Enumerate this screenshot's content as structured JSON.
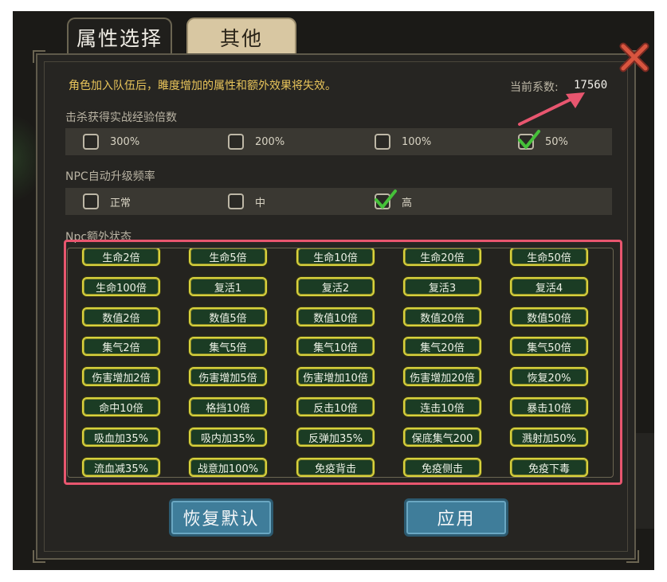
{
  "tabs": {
    "attribute": "属性选择",
    "other": "其他"
  },
  "notice": "角色加入队伍后，雎度增加的属性和额外效果将失效。",
  "coefficient": {
    "label": "当前系数:",
    "value": "17560"
  },
  "kill_exp": {
    "label": "击杀获得实战经验倍数",
    "options": [
      {
        "label": "300%",
        "checked": false
      },
      {
        "label": "200%",
        "checked": false
      },
      {
        "label": "100%",
        "checked": false
      },
      {
        "label": "50%",
        "checked": true
      }
    ]
  },
  "npc_upgrade": {
    "label": "NPC自动升级频率",
    "options": [
      {
        "label": "正常",
        "checked": false
      },
      {
        "label": "中",
        "checked": false
      },
      {
        "label": "高",
        "checked": true
      }
    ]
  },
  "npc_extra": {
    "label": "Npc额外状态",
    "buttons": [
      [
        "生命2倍",
        "生命5倍",
        "生命10倍",
        "生命20倍",
        "生命50倍"
      ],
      [
        "生命100倍",
        "复活1",
        "复活2",
        "复活3",
        "复活4"
      ],
      [
        "数值2倍",
        "数值5倍",
        "数值10倍",
        "数值20倍",
        "数值50倍"
      ],
      [
        "集气2倍",
        "集气5倍",
        "集气10倍",
        "集气20倍",
        "集气50倍"
      ],
      [
        "伤害增加2倍",
        "伤害增加5倍",
        "伤害增加10倍",
        "伤害增加20倍",
        "恢复20%"
      ],
      [
        "命中10倍",
        "格挡10倍",
        "反击10倍",
        "连击10倍",
        "暴击10倍"
      ],
      [
        "吸血加35%",
        "吸内加35%",
        "反弹加35%",
        "保底集气200",
        "溅射加50%"
      ],
      [
        "流血减35%",
        "战意加100%",
        "免疫背击",
        "免疫侧击",
        "免疫下毒"
      ]
    ]
  },
  "actions": {
    "reset": "恢复默认",
    "apply": "应用"
  },
  "colors": {
    "highlight": "#e8566f",
    "check": "#46c13a",
    "buff_border": "#d7d13d"
  }
}
